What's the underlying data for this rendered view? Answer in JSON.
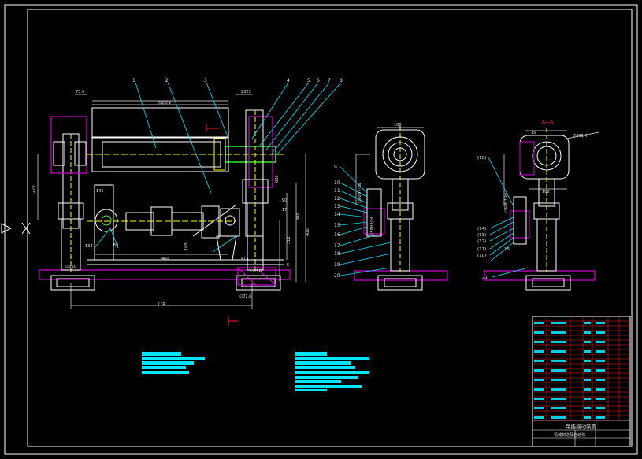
{
  "drawing": {
    "title_block_name": "吊挂摇动装置",
    "title_block_school": "机械制造及自动化",
    "view_label": "A—A",
    "thread_note": "2-M8/4"
  },
  "part_numbers": {
    "top": [
      "1",
      "2",
      "3",
      "4",
      "5",
      "6",
      "7",
      "8"
    ],
    "side": [
      "9",
      "10",
      "11",
      "12",
      "13",
      "14",
      "15",
      "16",
      "17",
      "18",
      "19",
      "20"
    ],
    "right": [
      "(18)",
      "(14)",
      "(13)",
      "(12)",
      "(11)",
      "(10)",
      "15",
      "21"
    ]
  },
  "dimensions": {
    "main": [
      "75.5",
      "∅8/∅9",
      "2325",
      "270",
      "145",
      "134",
      "60",
      "460",
      "180",
      "680",
      "415",
      "∅150",
      "∅150",
      "∅72.6",
      "778",
      "400",
      "380",
      "312",
      "17",
      "90",
      "5"
    ],
    "side": [
      "108",
      "∅60H7/k6",
      "∅50H7/k6"
    ],
    "right": [
      "15",
      "108",
      "∅60H7/k6"
    ]
  },
  "colors": {
    "background": "#000000",
    "frame": "#ffffff",
    "dim": "#e8e8e8",
    "leader": "#00e5ff",
    "part": "#ffffff",
    "magenta": "#d400d4",
    "yellow": "#ffff00",
    "green": "#33ff33",
    "red": "#ff2020",
    "table_text": "#00e5ff"
  }
}
